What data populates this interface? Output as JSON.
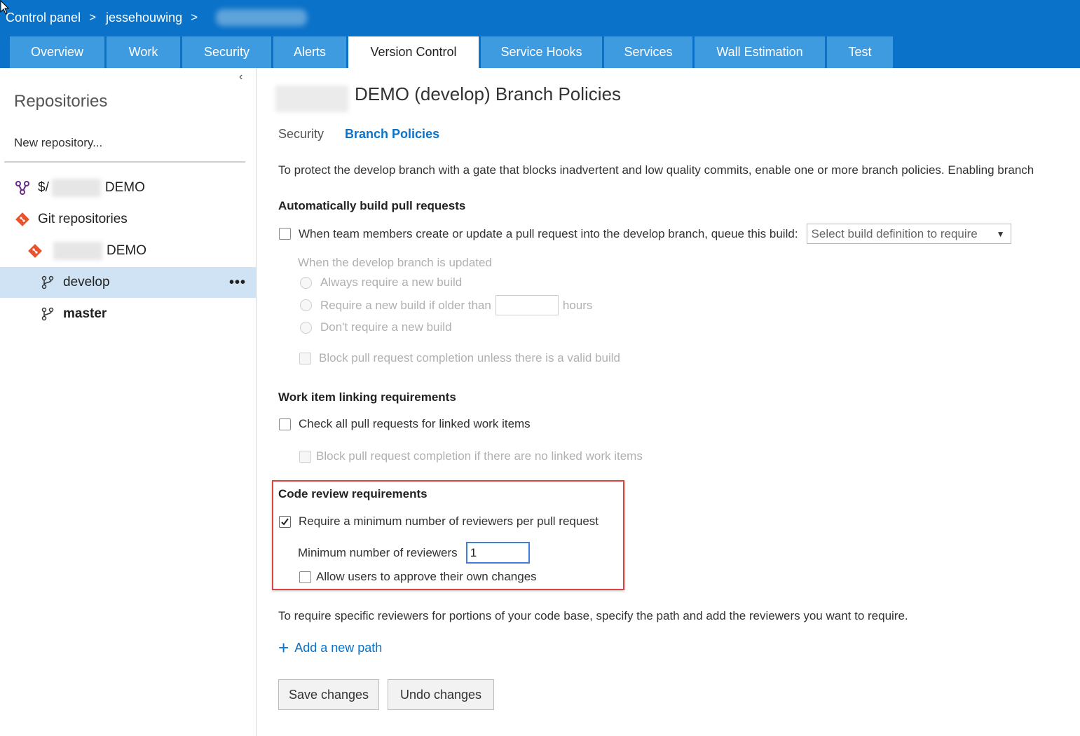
{
  "breadcrumb": {
    "items": [
      "Control panel",
      "jessehouwing"
    ],
    "separator": ">"
  },
  "tabs": [
    {
      "label": "Overview",
      "active": false
    },
    {
      "label": "Work",
      "active": false
    },
    {
      "label": "Security",
      "active": false
    },
    {
      "label": "Alerts",
      "active": false
    },
    {
      "label": "Version Control",
      "active": true
    },
    {
      "label": "Service Hooks",
      "active": false
    },
    {
      "label": "Services",
      "active": false
    },
    {
      "label": "Wall Estimation",
      "active": false
    },
    {
      "label": "Test",
      "active": false
    }
  ],
  "sidebar": {
    "collapse_glyph": "‹",
    "title": "Repositories",
    "new_repo": "New repository...",
    "tfvc_prefix": "$/",
    "tfvc_name": "DEMO",
    "git_group": "Git repositories",
    "git_repo": "DEMO",
    "branches": [
      {
        "name": "develop",
        "selected": true
      },
      {
        "name": "master",
        "selected": false
      }
    ],
    "more_glyph": "•••"
  },
  "main": {
    "title": "DEMO (develop) Branch Policies",
    "subnav": {
      "security": "Security",
      "branch_policies": "Branch Policies"
    },
    "intro": "To protect the develop branch with a gate that blocks inadvertent and low quality commits, enable one or more branch policies. Enabling branch",
    "build": {
      "heading": "Automatically build pull requests",
      "checkbox_label": "When team members create or update a pull request into the develop branch, queue this build:",
      "select_placeholder": "Select build definition to require",
      "updated_label": "When the develop branch is updated",
      "option_always": "Always require a new build",
      "option_older": "Require a new build if older than",
      "hours": "hours",
      "option_dont": "Don't require a new build",
      "block_label": "Block pull request completion unless there is a valid build"
    },
    "workitem": {
      "heading": "Work item linking requirements",
      "checkbox_label": "Check all pull requests for linked work items",
      "block_label": "Block pull request completion if there are no linked work items"
    },
    "codereview": {
      "heading": "Code review requirements",
      "min_reviewers_checkbox": "Require a minimum number of reviewers per pull request",
      "min_reviewers_checked": true,
      "min_reviewers_label": "Minimum number of reviewers",
      "min_reviewers_value": "1",
      "allow_own_label": "Allow users to approve their own changes"
    },
    "specific_reviewers_text": "To require specific reviewers for portions of your code base, specify the path and add the reviewers you want to require.",
    "add_path": "Add a new path",
    "save_button": "Save changes",
    "undo_button": "Undo changes"
  },
  "colors": {
    "header_bg": "#0a72c8",
    "tab_bg": "#3f9be0",
    "link": "#0a72c8",
    "selected_row": "#cfe3f4",
    "highlight_border": "#d9453f"
  }
}
